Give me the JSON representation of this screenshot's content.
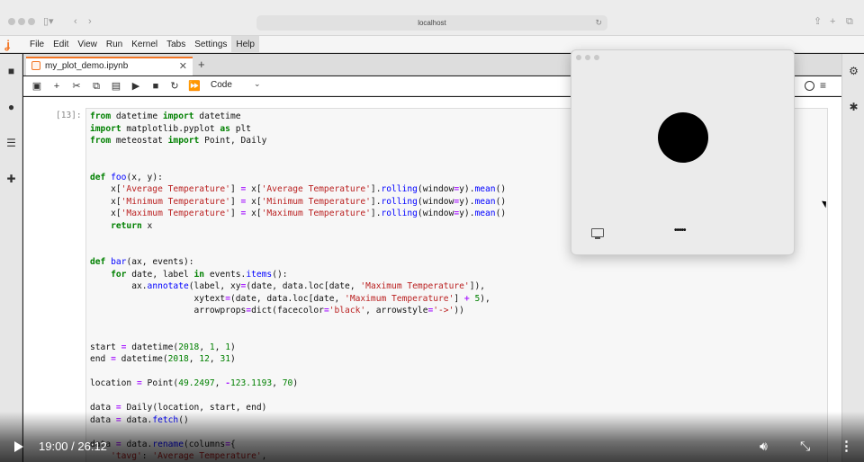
{
  "browser": {
    "url": "localhost"
  },
  "menubar": {
    "items": [
      "File",
      "Edit",
      "View",
      "Run",
      "Kernel",
      "Tabs",
      "Settings",
      "Help"
    ]
  },
  "tab": {
    "title": "my_plot_demo.ipynb"
  },
  "toolbar": {
    "cell_type": "Code"
  },
  "cell": {
    "prompt": "[13]:",
    "code_lines": [
      "from datetime import datetime",
      "import matplotlib.pyplot as plt",
      "from meteostat import Point, Daily",
      "",
      "",
      "def foo(x, y):",
      "    x['Average Temperature'] = x['Average Temperature'].rolling(window=y).mean()",
      "    x['Minimum Temperature'] = x['Minimum Temperature'].rolling(window=y).mean()",
      "    x['Maximum Temperature'] = x['Maximum Temperature'].rolling(window=y).mean()",
      "    return x",
      "",
      "",
      "def bar(ax, events):",
      "    for date, label in events.items():",
      "        ax.annotate(label, xy=(date, data.loc[date, 'Maximum Temperature']),",
      "                    xytext=(date, data.loc[date, 'Maximum Temperature'] + 5),",
      "                    arrowprops=dict(facecolor='black', arrowstyle='->'))",
      "",
      "",
      "start = datetime(2018, 1, 1)",
      "end = datetime(2018, 12, 31)",
      "",
      "location = Point(49.2497, -123.1193, 70)",
      "",
      "data = Daily(location, start, end)",
      "data = data.fetch()",
      "",
      "data = data.rename(columns={",
      "    'tavg': 'Average Temperature',"
    ]
  },
  "kernel": {
    "tail": ")"
  },
  "video": {
    "time": "19:00 / 26:12"
  },
  "colors": {
    "accent": "#f37726"
  }
}
